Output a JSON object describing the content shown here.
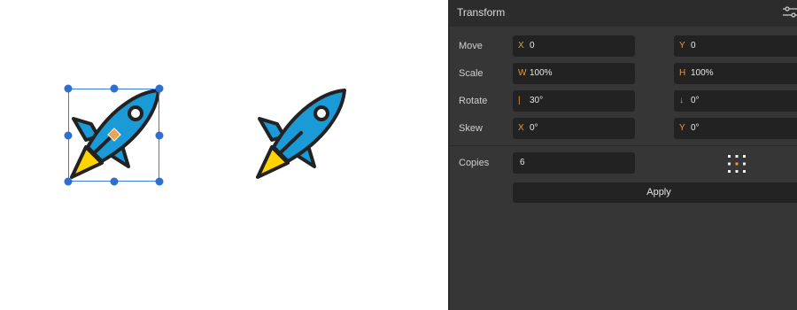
{
  "panel": {
    "title": "Transform",
    "settings_icon": "sliders-icon",
    "rows": {
      "move": {
        "label": "Move",
        "a_prefix": "X",
        "a_value": "0",
        "b_prefix": "Y",
        "b_value": "0"
      },
      "scale": {
        "label": "Scale",
        "a_prefix": "W",
        "a_value": "100%",
        "b_prefix": "H",
        "b_value": "100%"
      },
      "rotate": {
        "label": "Rotate",
        "a_prefix": "|",
        "a_value": "30°",
        "b_prefix": "↓",
        "b_value": "0°"
      },
      "skew": {
        "label": "Skew",
        "a_prefix": "X",
        "a_value": "0°",
        "b_prefix": "Y",
        "b_value": "0°"
      }
    },
    "copies": {
      "label": "Copies",
      "value": "6"
    },
    "origin_icon": "anchor-grid-icon",
    "apply_label": "Apply"
  },
  "colors": {
    "accent": "#e69a4a",
    "selection": "#3d7fd9",
    "panel_bg": "#363636",
    "field_bg": "#222222",
    "rocket_body": "#1a9bd7",
    "rocket_flame": "#ffd400",
    "outline": "#222222"
  }
}
